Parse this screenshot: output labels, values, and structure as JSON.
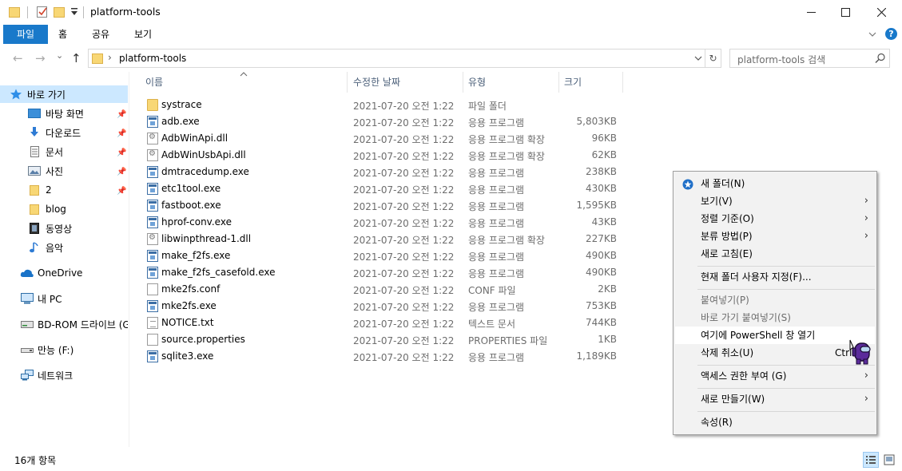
{
  "window": {
    "title": "platform-tools",
    "controls": {
      "minimize": "—",
      "maximize": "☐",
      "close": "✕"
    }
  },
  "ribbon": {
    "tabs": [
      "파일",
      "홈",
      "공유",
      "보기"
    ],
    "collapse": "⌄",
    "help": "?"
  },
  "address": {
    "back": "←",
    "forward": "→",
    "recent": "⌄",
    "up": "↑",
    "path": "platform-tools",
    "separator": "›",
    "dropdown": "⌄",
    "refresh": "↻",
    "search_placeholder": "platform-tools 검색",
    "search_icon": "⌕"
  },
  "sidebar": {
    "items": [
      {
        "label": "바로 가기",
        "icon": "star-icon",
        "pinned": false
      },
      {
        "label": "바탕 화면",
        "icon": "desktop-icon",
        "pinned": true
      },
      {
        "label": "다운로드",
        "icon": "download-icon",
        "pinned": true
      },
      {
        "label": "문서",
        "icon": "document-icon",
        "pinned": true
      },
      {
        "label": "사진",
        "icon": "picture-icon",
        "pinned": true
      },
      {
        "label": "2",
        "icon": "folder-icon",
        "pinned": true
      },
      {
        "label": "blog",
        "icon": "folder-icon",
        "pinned": false
      },
      {
        "label": "동영상",
        "icon": "video-icon",
        "pinned": false
      },
      {
        "label": "음악",
        "icon": "music-icon",
        "pinned": false
      },
      {
        "label": "OneDrive",
        "icon": "cloud-icon",
        "pinned": false
      },
      {
        "label": "내 PC",
        "icon": "computer-icon",
        "pinned": false
      },
      {
        "label": "BD-ROM 드라이브 (G",
        "icon": "disc-drive-icon",
        "pinned": false
      },
      {
        "label": "만능 (F:)",
        "icon": "usb-drive-icon",
        "pinned": false
      },
      {
        "label": "네트워크",
        "icon": "network-icon",
        "pinned": false
      }
    ]
  },
  "columns": {
    "name": "이름",
    "date": "수정한 날짜",
    "type": "유형",
    "size": "크기",
    "sort_indicator": "^"
  },
  "files": [
    {
      "name": "systrace",
      "date": "2021-07-20 오전 1:22",
      "type": "파일 폴더",
      "size": "",
      "kind": "folder"
    },
    {
      "name": "adb.exe",
      "date": "2021-07-20 오전 1:22",
      "type": "응용 프로그램",
      "size": "5,803KB",
      "kind": "exe"
    },
    {
      "name": "AdbWinApi.dll",
      "date": "2021-07-20 오전 1:22",
      "type": "응용 프로그램 확장",
      "size": "96KB",
      "kind": "dll"
    },
    {
      "name": "AdbWinUsbApi.dll",
      "date": "2021-07-20 오전 1:22",
      "type": "응용 프로그램 확장",
      "size": "62KB",
      "kind": "dll"
    },
    {
      "name": "dmtracedump.exe",
      "date": "2021-07-20 오전 1:22",
      "type": "응용 프로그램",
      "size": "238KB",
      "kind": "exe"
    },
    {
      "name": "etc1tool.exe",
      "date": "2021-07-20 오전 1:22",
      "type": "응용 프로그램",
      "size": "430KB",
      "kind": "exe"
    },
    {
      "name": "fastboot.exe",
      "date": "2021-07-20 오전 1:22",
      "type": "응용 프로그램",
      "size": "1,595KB",
      "kind": "exe"
    },
    {
      "name": "hprof-conv.exe",
      "date": "2021-07-20 오전 1:22",
      "type": "응용 프로그램",
      "size": "43KB",
      "kind": "exe"
    },
    {
      "name": "libwinpthread-1.dll",
      "date": "2021-07-20 오전 1:22",
      "type": "응용 프로그램 확장",
      "size": "227KB",
      "kind": "dll"
    },
    {
      "name": "make_f2fs.exe",
      "date": "2021-07-20 오전 1:22",
      "type": "응용 프로그램",
      "size": "490KB",
      "kind": "exe"
    },
    {
      "name": "make_f2fs_casefold.exe",
      "date": "2021-07-20 오전 1:22",
      "type": "응용 프로그램",
      "size": "490KB",
      "kind": "exe"
    },
    {
      "name": "mke2fs.conf",
      "date": "2021-07-20 오전 1:22",
      "type": "CONF 파일",
      "size": "2KB",
      "kind": "doc"
    },
    {
      "name": "mke2fs.exe",
      "date": "2021-07-20 오전 1:22",
      "type": "응용 프로그램",
      "size": "753KB",
      "kind": "exe"
    },
    {
      "name": "NOTICE.txt",
      "date": "2021-07-20 오전 1:22",
      "type": "텍스트 문서",
      "size": "744KB",
      "kind": "txt"
    },
    {
      "name": "source.properties",
      "date": "2021-07-20 오전 1:22",
      "type": "PROPERTIES 파일",
      "size": "1KB",
      "kind": "doc"
    },
    {
      "name": "sqlite3.exe",
      "date": "2021-07-20 오전 1:22",
      "type": "응용 프로그램",
      "size": "1,189KB",
      "kind": "exe"
    }
  ],
  "status": {
    "item_count": "16개 항목"
  },
  "context_menu": {
    "items": [
      {
        "label": "새 폴더(N)",
        "icon": "new-folder-icon",
        "submenu": false,
        "disabled": false,
        "highlighted": false,
        "shortcut": ""
      },
      {
        "label": "보기(V)",
        "submenu": true,
        "disabled": false,
        "highlighted": false,
        "shortcut": ""
      },
      {
        "label": "정렬 기준(O)",
        "submenu": true,
        "disabled": false,
        "highlighted": false,
        "shortcut": ""
      },
      {
        "label": "분류 방법(P)",
        "submenu": true,
        "disabled": false,
        "highlighted": false,
        "shortcut": ""
      },
      {
        "label": "새로 고침(E)",
        "submenu": false,
        "disabled": false,
        "highlighted": false,
        "shortcut": ""
      },
      {
        "separator": true
      },
      {
        "label": "현재 폴더 사용자 지정(F)...",
        "submenu": false,
        "disabled": false,
        "highlighted": false,
        "shortcut": ""
      },
      {
        "separator": true
      },
      {
        "label": "붙여넣기(P)",
        "submenu": false,
        "disabled": true,
        "highlighted": false,
        "shortcut": ""
      },
      {
        "label": "바로 가기 붙여넣기(S)",
        "submenu": false,
        "disabled": true,
        "highlighted": false,
        "shortcut": ""
      },
      {
        "label": "여기에 PowerShell 창 열기",
        "submenu": false,
        "disabled": false,
        "highlighted": true,
        "shortcut": ""
      },
      {
        "label": "삭제 취소(U)",
        "submenu": false,
        "disabled": false,
        "highlighted": false,
        "shortcut": "Ctrl"
      },
      {
        "separator": true
      },
      {
        "label": "액세스 권한 부여 (G)",
        "submenu": true,
        "disabled": false,
        "highlighted": false,
        "shortcut": ""
      },
      {
        "separator": true
      },
      {
        "label": "새로 만들기(W)",
        "submenu": true,
        "disabled": false,
        "highlighted": false,
        "shortcut": ""
      },
      {
        "separator": true
      },
      {
        "label": "속성(R)",
        "submenu": false,
        "disabled": false,
        "highlighted": false,
        "shortcut": ""
      }
    ],
    "submenu_arrow": "›"
  },
  "colors": {
    "accent": "#1979ca",
    "selection": "#cce8ff",
    "header_text": "#4c607a",
    "folder": "#f8d775",
    "cursor": "#5b2b9b"
  }
}
